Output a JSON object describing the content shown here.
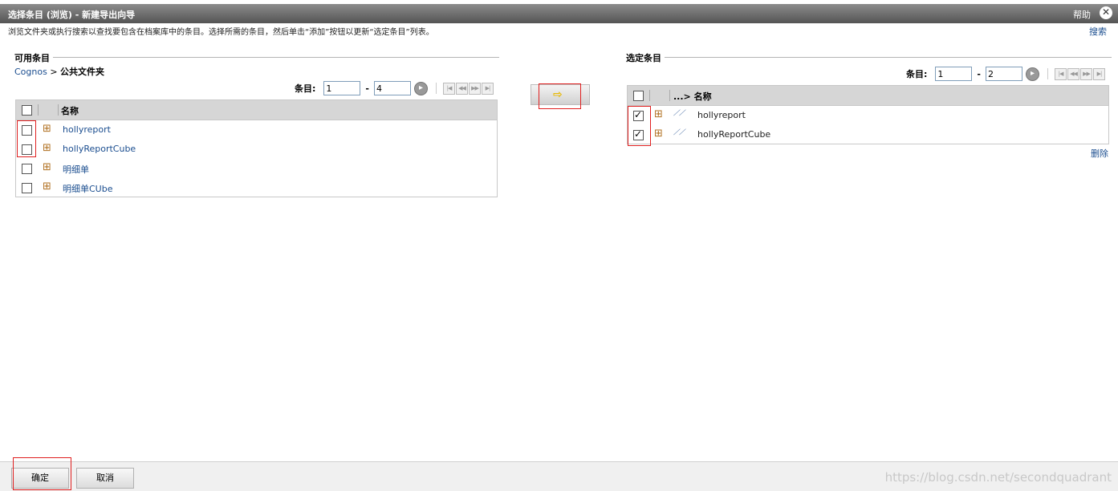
{
  "window": {
    "title": "选择条目 (浏览) - 新建导出向导",
    "help_label": "帮助",
    "close_glyph": "✕"
  },
  "instructions": "浏览文件夹或执行搜索以查找要包含在档案库中的条目。选择所需的条目，然后单击“添加”按钮以更新“选定条目”列表。",
  "search_label": "搜索",
  "available": {
    "title": "可用条目",
    "breadcrumb_root": "Cognos",
    "breadcrumb_sep": ">",
    "breadcrumb_current": "公共文件夹",
    "pager": {
      "label": "条目:",
      "from": "1",
      "to": "4"
    },
    "column_name": "名称",
    "items": [
      {
        "name": "hollyreport",
        "checked": false
      },
      {
        "name": "hollyReportCube",
        "checked": false
      },
      {
        "name": "明细单",
        "checked": false
      },
      {
        "name": "明细单CUbe",
        "checked": false
      }
    ]
  },
  "selected": {
    "title": "选定条目",
    "pager": {
      "label": "条目:",
      "from": "1",
      "to": "2"
    },
    "column_name": "...> 名称",
    "items": [
      {
        "name": "hollyreport",
        "checked": true
      },
      {
        "name": "hollyReportCube",
        "checked": true
      }
    ],
    "delete_label": "删除"
  },
  "add_button_glyph": "⇨",
  "footer": {
    "ok_label": "确定",
    "cancel_label": "取消",
    "watermark": "https://blog.csdn.net/secondquadrant"
  },
  "colors": {
    "link": "#1a4d8f",
    "highlight": "#e02020",
    "titlebar": "#5c5c5c"
  }
}
